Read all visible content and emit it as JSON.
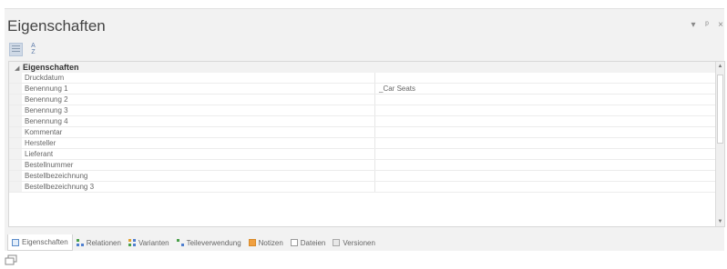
{
  "panel": {
    "title": "Eigenschaften",
    "controls": [
      "▾",
      "ᵖ",
      "×"
    ]
  },
  "grid": {
    "category": "Eigenschaften",
    "rows": [
      {
        "name": "Druckdatum",
        "value": ""
      },
      {
        "name": "Benennung 1",
        "value": "_Car Seats"
      },
      {
        "name": "Benennung 2",
        "value": ""
      },
      {
        "name": "Benennung 3",
        "value": ""
      },
      {
        "name": "Benennung 4",
        "value": ""
      },
      {
        "name": "Kommentar",
        "value": ""
      },
      {
        "name": "Hersteller",
        "value": ""
      },
      {
        "name": "Lieferant",
        "value": ""
      },
      {
        "name": "Bestellnummer",
        "value": ""
      },
      {
        "name": "Bestellbezeichnung",
        "value": ""
      },
      {
        "name": "Bestellbezeichnung 3",
        "value": ""
      }
    ]
  },
  "toolbar": {
    "sort_label": "A↓Z"
  },
  "tabs": [
    {
      "label": "Eigenschaften",
      "icon": "properties-icon"
    },
    {
      "label": "Relationen",
      "icon": "relations-icon"
    },
    {
      "label": "Varianten",
      "icon": "variants-icon"
    },
    {
      "label": "Teileverwendung",
      "icon": "part-usage-icon"
    },
    {
      "label": "Notizen",
      "icon": "notes-icon"
    },
    {
      "label": "Dateien",
      "icon": "files-icon"
    },
    {
      "label": "Versionen",
      "icon": "versions-icon"
    }
  ]
}
